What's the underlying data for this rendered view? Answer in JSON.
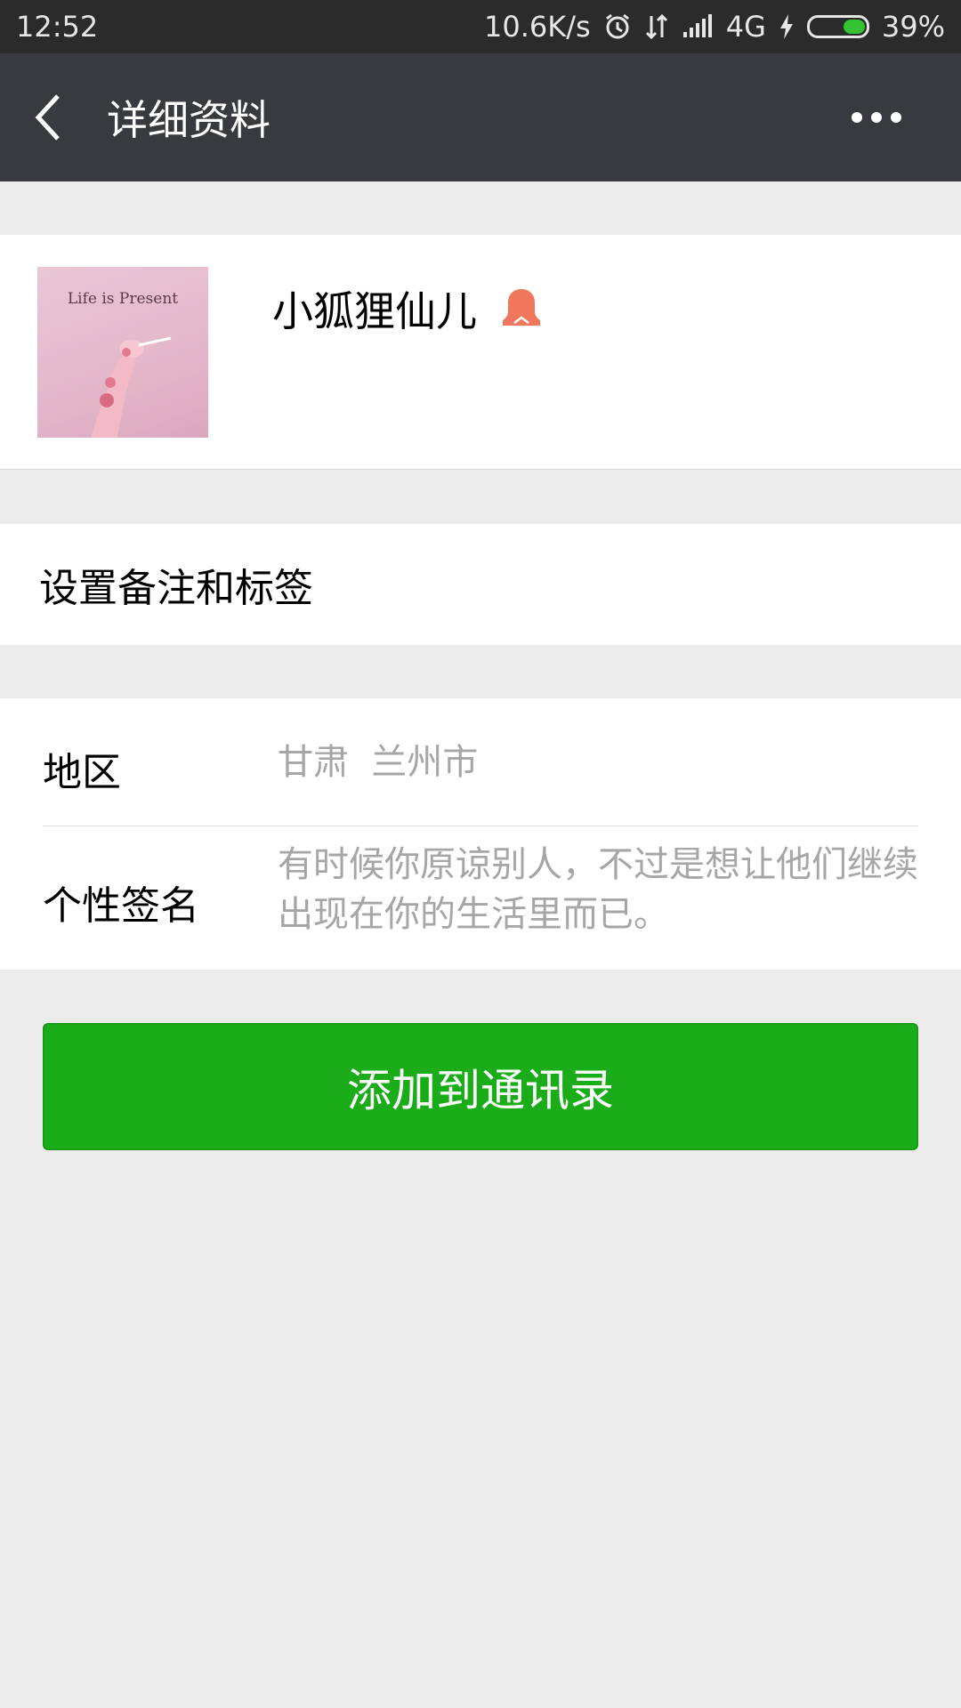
{
  "status_bar": {
    "time": "12:52",
    "net_speed": "10.6K/s",
    "network": "4G",
    "battery_percent": "39%",
    "battery_level": 0.39
  },
  "nav": {
    "title": "详细资料"
  },
  "profile": {
    "avatar_caption": "Life is Present",
    "nickname": "小狐狸仙儿",
    "gender_icon": "female-icon"
  },
  "remark": {
    "label": "设置备注和标签"
  },
  "info": {
    "region_label": "地区",
    "region_value": "甘肃  兰州市",
    "signature_label": "个性签名",
    "signature_value": "有时候你原谅别人，不过是想让他们继续出现在你的生活里而已。"
  },
  "actions": {
    "add_contact_label": "添加到通讯录"
  },
  "colors": {
    "accent_green": "#1aad19",
    "title_bar": "#393a3f",
    "gender_icon": "#f0775c"
  }
}
